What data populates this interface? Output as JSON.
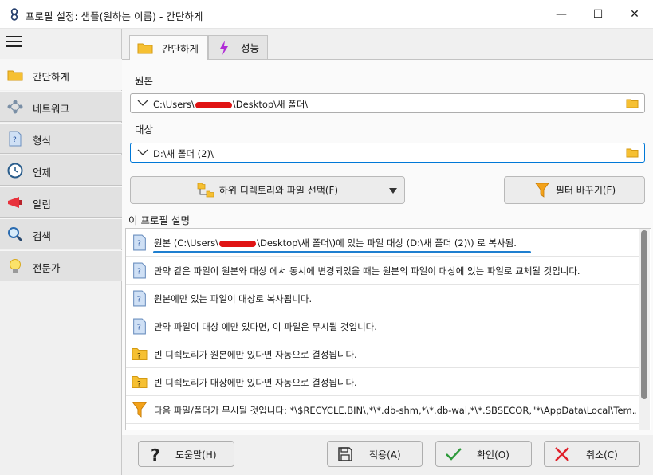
{
  "window": {
    "title": "프로필 설정: 샘플(원하는 이름) - 간단하게",
    "minimize_glyph": "—",
    "maximize_glyph": "☐",
    "close_glyph": "✕"
  },
  "sidebar": {
    "items": [
      {
        "label": "간단하게",
        "icon": "folder-icon",
        "active": true
      },
      {
        "label": "네트워크",
        "icon": "network-icon"
      },
      {
        "label": "형식",
        "icon": "document-question-icon"
      },
      {
        "label": "언제",
        "icon": "clock-icon"
      },
      {
        "label": "알림",
        "icon": "megaphone-icon"
      },
      {
        "label": "검색",
        "icon": "magnifier-icon"
      },
      {
        "label": "전문가",
        "icon": "lightbulb-icon"
      }
    ]
  },
  "tabs": [
    {
      "label": "간단하게",
      "icon": "folder-icon",
      "active": true
    },
    {
      "label": "성능",
      "icon": "lightning-icon",
      "active": false
    }
  ],
  "source": {
    "label": "원본",
    "value_prefix": "C:\\Users\\",
    "value_suffix": "\\Desktop\\새 폴더\\"
  },
  "target": {
    "label": "대상",
    "value": "D:\\새 폴더 (2)\\"
  },
  "buttons": {
    "subdir_select": "하위 디렉토리와 파일 선택(F)",
    "change_filter": "필터 바꾸기(F)",
    "help": "도움말(H)",
    "apply": "적용(A)",
    "ok": "확인(O)",
    "cancel": "취소(C)"
  },
  "description": {
    "label": "이 프로필 설명",
    "rows": [
      {
        "icon": "document-question-icon",
        "prefix": "원본 (C:\\Users\\",
        "suffix": "\\Desktop\\새 폴더\\)에 있는 파일 대상 (D:\\새 폴더 (2)\\) 로 복사됨."
      },
      {
        "icon": "document-question-icon",
        "text": "만약 같은 파일이 원본와 대상 에서 동시에 변경되었을 때는 원본의 파일이 대상에 있는 파일로 교체될 것입니다."
      },
      {
        "icon": "document-question-icon",
        "text": "원본에만 있는 파일이 대상로 복사됩니다."
      },
      {
        "icon": "document-question-icon",
        "text": "만약 파일이 대상 에만 있다면, 이 파일은 무시될 것입니다."
      },
      {
        "icon": "folder-question-icon",
        "text": "빈 디렉토리가 원본에만 있다면 자동으로 결정됩니다."
      },
      {
        "icon": "folder-question-icon",
        "text": "빈 디렉토리가 대상에만 있다면 자동으로 결정됩니다."
      },
      {
        "icon": "funnel-icon",
        "text": "다음 파일/폴더가 무시될 것입니다: *\\$RECYCLE.BIN\\,*\\*.db-shm,*\\*.db-wal,*\\*.SBSECOR,\"*\\AppData\\Local\\Tem..."
      }
    ]
  }
}
